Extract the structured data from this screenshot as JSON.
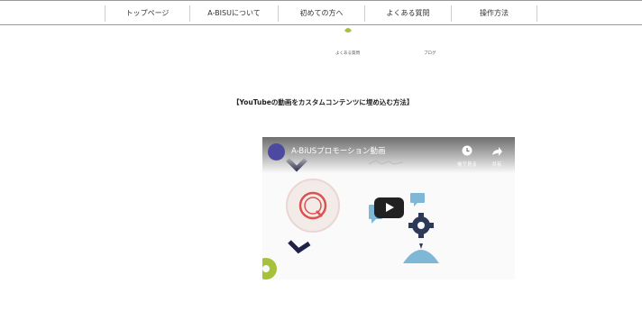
{
  "nav": {
    "items": [
      "トップページ",
      "A-BISUについて",
      "初めての方へ",
      "よくある質問",
      "操作方法"
    ]
  },
  "icons_row": {
    "faq_label": "よくある質問",
    "blog_label": "ブログ"
  },
  "section": {
    "title": "【YouTubeの動画をカスタムコンテンツに埋め込む方法】"
  },
  "video": {
    "title": "A-BiUSプロモーション動画",
    "watch_later_label": "後で見る",
    "share_label": "共有"
  },
  "colors": {
    "nav_border": "#9a9a9a",
    "play_button": "#212121",
    "channel_icon": "#4b4aa0",
    "accent_blue": "#7fb7d6",
    "accent_red": "#d9534f",
    "navy": "#1f2147",
    "lime": "#a6c13a"
  }
}
